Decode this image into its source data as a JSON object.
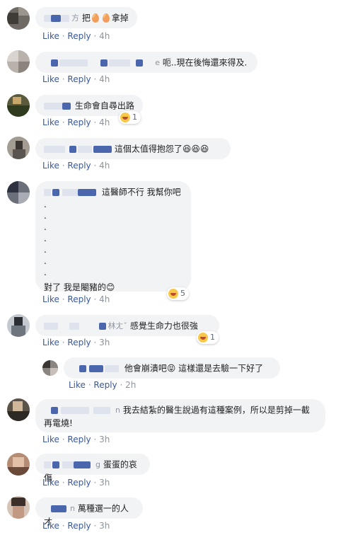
{
  "actions": {
    "like": "Like",
    "reply": "Reply",
    "sep": "·"
  },
  "reaction_type": "haha",
  "colors": {
    "link": "#385898",
    "meta": "#8d949e",
    "bubble": "#f2f3f5",
    "text": "#1c1e21",
    "author_blur": "#4a66ad"
  },
  "comments": [
    {
      "author_tail": "方",
      "text": "把🥚🥚拿掉",
      "time": "4h"
    },
    {
      "author_tail": "e",
      "text": "呃..現在後悔還來得及.",
      "time": "4h"
    },
    {
      "author_tail": "",
      "text": "生命會自尋出路",
      "time": "4h",
      "reaction_count": "1"
    },
    {
      "author_tail": "",
      "text": "這個太值得抱怨了😆😆😆",
      "time": "4h"
    },
    {
      "author_tail": "",
      "text": "這醫師不行 我幫你吧",
      "dots": [
        ".",
        ".",
        ".",
        ".",
        ".",
        ".",
        "."
      ],
      "text2": "對了 我是閹豬的😊",
      "time": "4h",
      "reaction_count": "5"
    },
    {
      "author_tail": "林ㄤˇ",
      "text": "感覺生命力也很強",
      "time": "3h",
      "reaction_count": "1"
    },
    {
      "author_tail": "",
      "text": "他會崩潰吧😝 這樣還是去驗一下好了",
      "time": "2h"
    },
    {
      "author_tail": "n",
      "text": "我去結紮的醫生說過有這種案例，所以是剪掉一截",
      "text2": "再電燒!",
      "time": "3h"
    },
    {
      "author_tail": "g",
      "text": "蛋蛋的哀傷",
      "time": "3h"
    },
    {
      "author_tail": "n",
      "text": "萬種選一的人才",
      "time": "3h"
    }
  ]
}
